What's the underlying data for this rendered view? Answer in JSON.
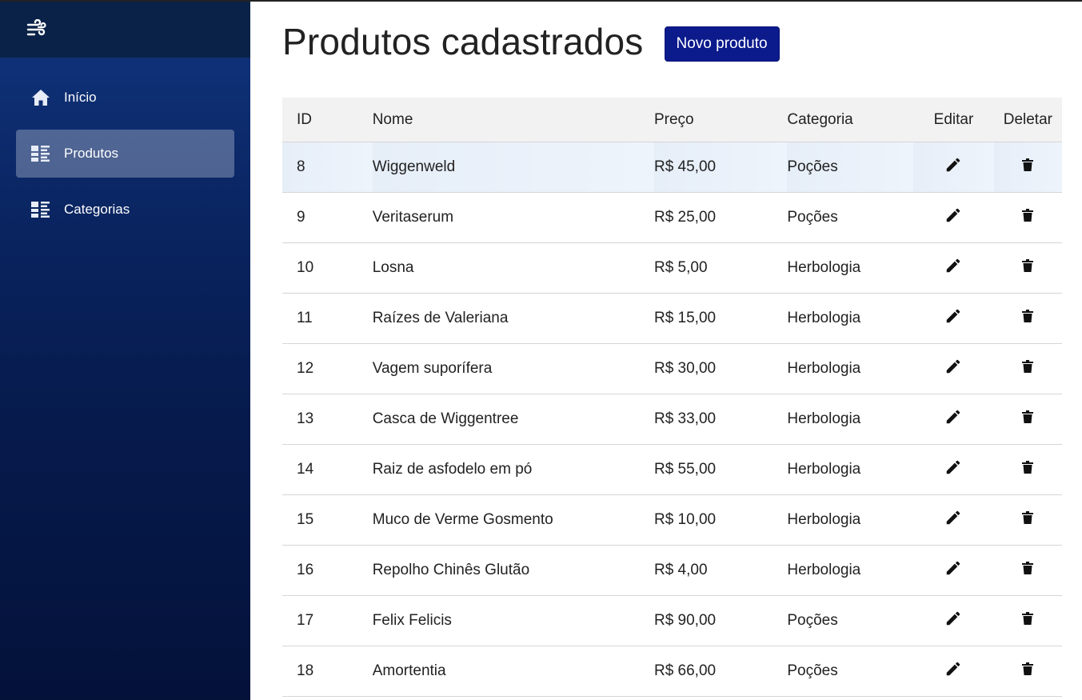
{
  "sidebar": {
    "logo_icon": "wind-logo-icon",
    "items": [
      {
        "label": "Início",
        "icon": "home-icon",
        "active": false
      },
      {
        "label": "Produtos",
        "icon": "list-icon",
        "active": true
      },
      {
        "label": "Categorias",
        "icon": "list-icon",
        "active": false
      }
    ]
  },
  "header": {
    "title": "Produtos cadastrados",
    "new_button_label": "Novo produto"
  },
  "table": {
    "columns": [
      "ID",
      "Nome",
      "Preço",
      "Categoria",
      "Editar",
      "Deletar"
    ],
    "rows": [
      {
        "id": "8",
        "name": "Wiggenweld",
        "price": "R$ 45,00",
        "category": "Poções"
      },
      {
        "id": "9",
        "name": "Veritaserum",
        "price": "R$ 25,00",
        "category": "Poções"
      },
      {
        "id": "10",
        "name": "Losna",
        "price": "R$ 5,00",
        "category": "Herbologia"
      },
      {
        "id": "11",
        "name": "Raízes de Valeriana",
        "price": "R$ 15,00",
        "category": "Herbologia"
      },
      {
        "id": "12",
        "name": "Vagem suporífera",
        "price": "R$ 30,00",
        "category": "Herbologia"
      },
      {
        "id": "13",
        "name": "Casca de Wiggentree",
        "price": "R$ 33,00",
        "category": "Herbologia"
      },
      {
        "id": "14",
        "name": "Raiz de asfodelo em pó",
        "price": "R$ 55,00",
        "category": "Herbologia"
      },
      {
        "id": "15",
        "name": "Muco de Verme Gosmento",
        "price": "R$ 10,00",
        "category": "Herbologia"
      },
      {
        "id": "16",
        "name": "Repolho Chinês Glutão",
        "price": "R$ 4,00",
        "category": "Herbologia"
      },
      {
        "id": "17",
        "name": "Felix Felicis",
        "price": "R$ 90,00",
        "category": "Poções"
      },
      {
        "id": "18",
        "name": "Amortentia",
        "price": "R$ 66,00",
        "category": "Poções"
      }
    ],
    "edit_icon": "pencil-icon",
    "delete_icon": "trash-icon"
  },
  "colors": {
    "sidebar_top": "#0a2248",
    "sidebar_gradient_start": "#11357f",
    "sidebar_gradient_end": "#04123a",
    "button_primary": "#0b1b8c",
    "header_row_bg": "#f2f2f2",
    "highlight_row_bg": "#e6eef8"
  }
}
